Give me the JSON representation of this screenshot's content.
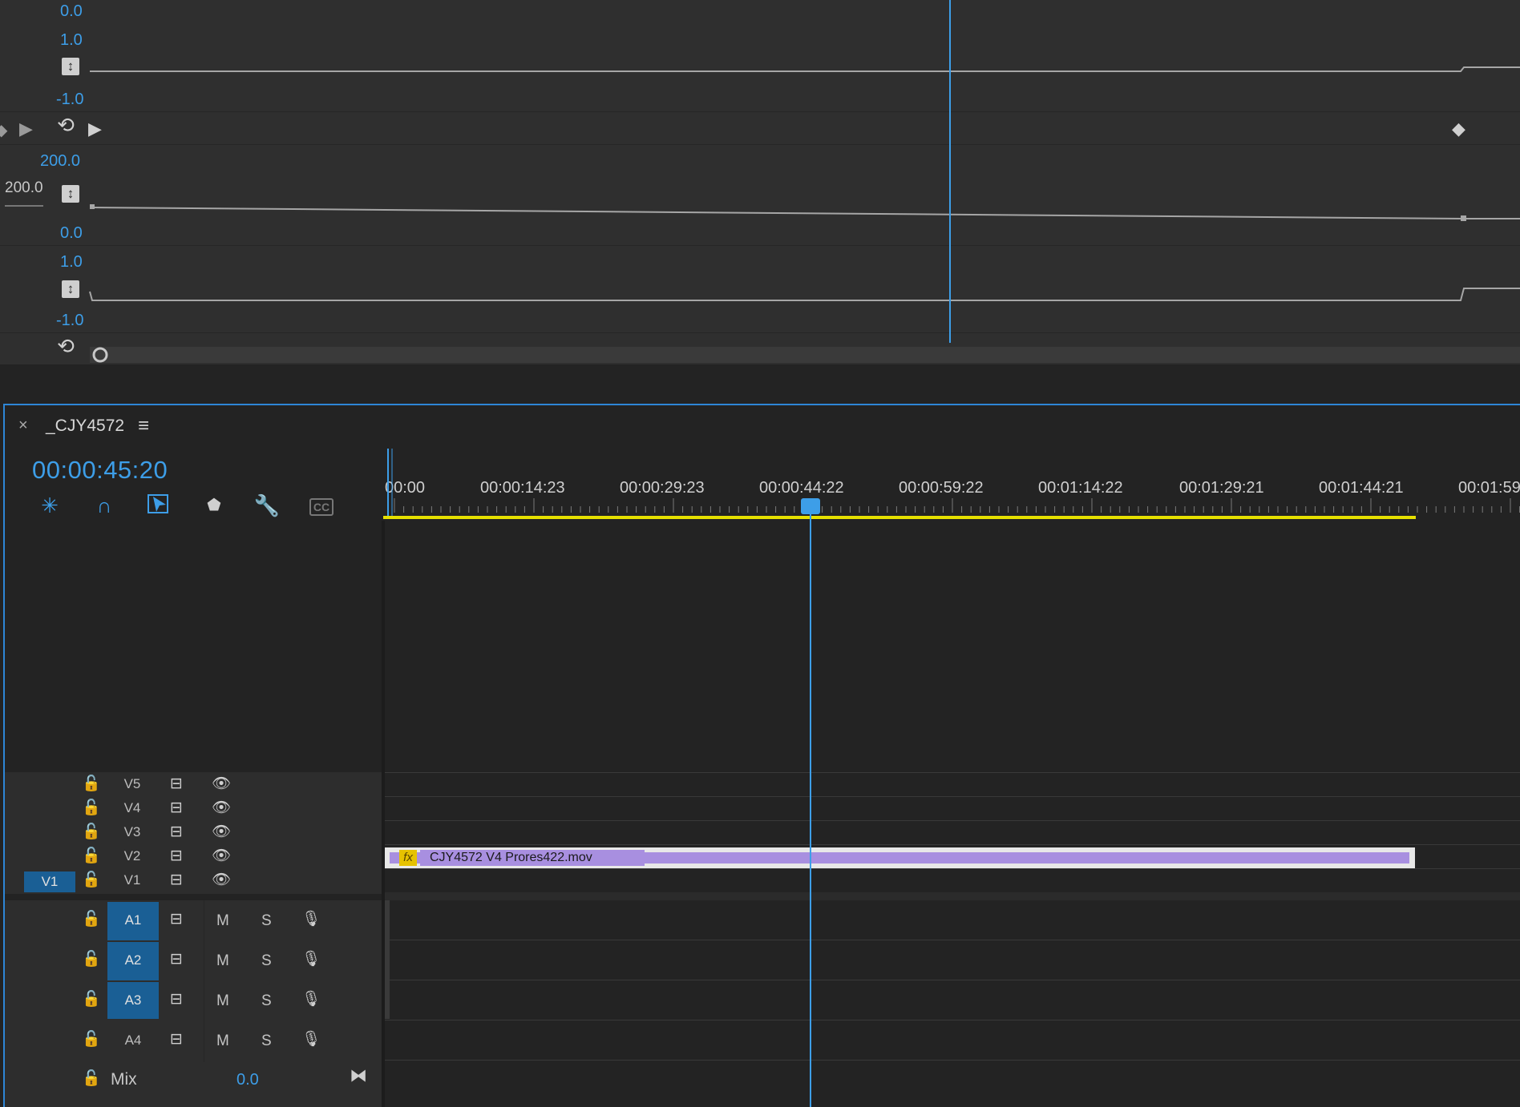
{
  "colors": {
    "accent": "#3d9ee8",
    "work_area": "#e6e000",
    "clip_video": "#a88fe0",
    "target_blue": "#1a5f95"
  },
  "effect_graph": {
    "rows": [
      {
        "top": "0.0",
        "max": "1.0",
        "min": "-1.0"
      },
      {
        "max": "200.0",
        "value": "200.0",
        "min": "0.0"
      },
      {
        "max": "1.0",
        "min": "-1.0"
      }
    ]
  },
  "timeline": {
    "tab_close": "×",
    "sequence_name": "_CJY4572",
    "menu_icon": "≡",
    "timecode": "00:00:45:20",
    "ruler_labels": [
      "00:00",
      "00:00:14:23",
      "00:00:29:23",
      "00:00:44:22",
      "00:00:59:22",
      "00:01:14:22",
      "00:01:29:21",
      "00:01:44:21",
      "00:01:59"
    ],
    "toolbar": [
      "nest-icon",
      "snap-magnet-icon",
      "linked-selection-icon",
      "marker-icon",
      "wrench-icon",
      "captions-icon"
    ],
    "toolbar_text": {
      "captions": "CC"
    },
    "video_tracks": [
      {
        "label": "V5",
        "source": ""
      },
      {
        "label": "V4",
        "source": ""
      },
      {
        "label": "V3",
        "source": ""
      },
      {
        "label": "V2",
        "source": ""
      },
      {
        "label": "V1",
        "source": "V1"
      }
    ],
    "audio_tracks": [
      {
        "label": "A1",
        "targeted": true,
        "m": "M",
        "s": "S"
      },
      {
        "label": "A2",
        "targeted": true,
        "m": "M",
        "s": "S"
      },
      {
        "label": "A3",
        "targeted": true,
        "m": "M",
        "s": "S"
      },
      {
        "label": "A4",
        "targeted": false,
        "m": "M",
        "s": "S"
      }
    ],
    "mix": {
      "label": "Mix",
      "value": "0.0"
    },
    "clip": {
      "fx": "fx",
      "name": "CJY4572 V4 Prores422.mov"
    }
  }
}
